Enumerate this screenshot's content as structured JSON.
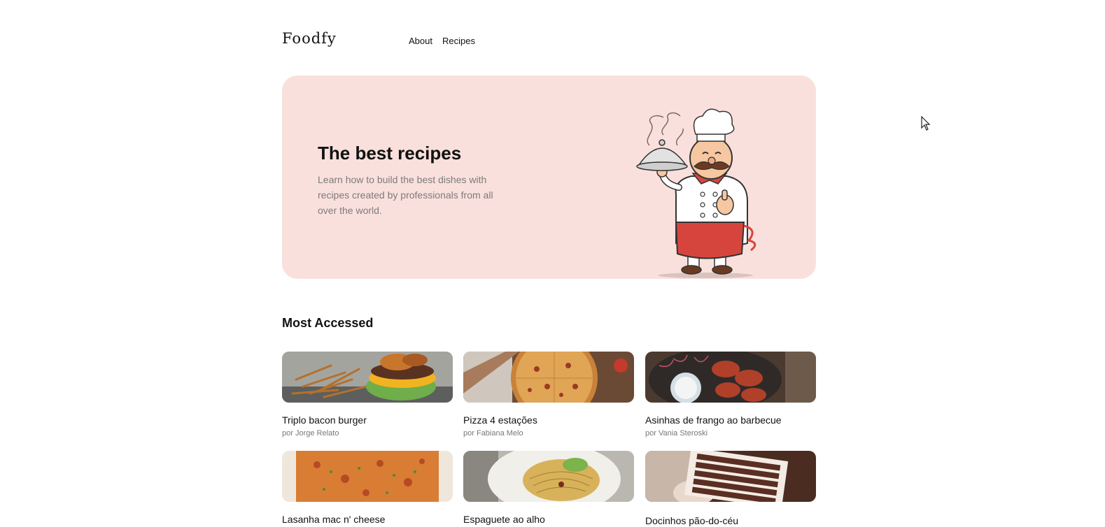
{
  "header": {
    "logo": "Foodfy",
    "nav": [
      {
        "label": "About"
      },
      {
        "label": "Recipes"
      }
    ]
  },
  "hero": {
    "title": "The best recipes",
    "description": "Learn how to build the best dishes with recipes created by professionals from all over the world.",
    "illustration": "chef-illustration"
  },
  "section": {
    "title": "Most Accessed"
  },
  "recipes": [
    {
      "title": "Triplo bacon burger",
      "author": "por Jorge Relato",
      "image": "burger-fries-photo"
    },
    {
      "title": "Pizza 4 estações",
      "author": "por Fabiana Melo",
      "image": "pizza-photo"
    },
    {
      "title": "Asinhas de frango ao barbecue",
      "author": "por Vania Steroski",
      "image": "chicken-wings-photo"
    },
    {
      "title": "Lasanha mac n' cheese",
      "author": "",
      "image": "lasagna-photo"
    },
    {
      "title": "Espaguete ao alho",
      "author": "",
      "image": "spaghetti-photo"
    },
    {
      "title": "Docinhos pão-do-céu",
      "author": "",
      "image": "sweets-photo"
    }
  ],
  "colors": {
    "hero_background": "#fae0dc",
    "text_primary": "#111111",
    "text_muted": "#7b7b7b"
  }
}
